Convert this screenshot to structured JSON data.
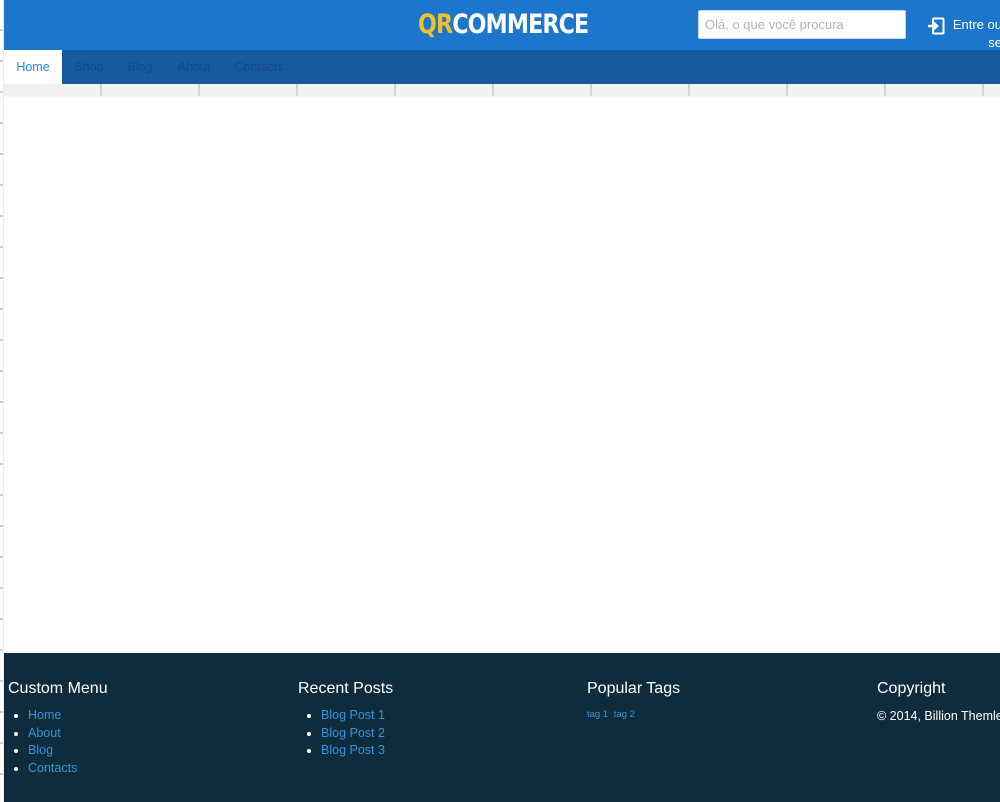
{
  "header": {
    "logo_qr": "QR",
    "logo_commerce": "COMMERCE",
    "search_placeholder": "Olá, o que você procura",
    "login_label": "Entre ou se",
    "colors": {
      "header_bg": "#1b76cc",
      "logo_accent": "#f3c02b",
      "nav_bg": "#155a9e"
    }
  },
  "nav": {
    "items": [
      {
        "label": "Home",
        "active": true
      },
      {
        "label": "Shop",
        "active": false
      },
      {
        "label": "Blog",
        "active": false
      },
      {
        "label": "About",
        "active": false
      },
      {
        "label": "Contacts",
        "active": false
      }
    ]
  },
  "footer": {
    "custom_menu": {
      "heading": "Custom Menu",
      "items": [
        "Home",
        "About",
        "Blog",
        "Contacts"
      ]
    },
    "recent_posts": {
      "heading": "Recent Posts",
      "items": [
        "Blog Post 1",
        "Blog Post 2",
        "Blog Post 3"
      ]
    },
    "popular_tags": {
      "heading": "Popular Tags",
      "tags": [
        "tag 1",
        "tag 2"
      ]
    },
    "copyright": {
      "heading": "Copyright",
      "text": "© 2014, Billion Themle"
    },
    "colors": {
      "footer_bg": "#0f2c3c",
      "link": "#2f95dc"
    }
  },
  "icons": {
    "login": "sign-in-icon"
  }
}
